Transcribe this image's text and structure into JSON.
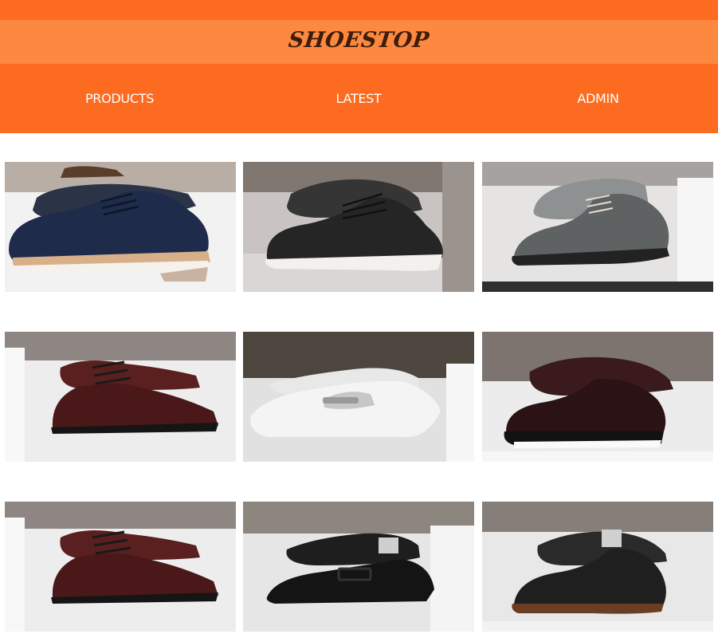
{
  "header": {
    "brand": "SHOESTOP"
  },
  "nav": {
    "items": [
      "PRODUCTS",
      "LATEST",
      "ADMIN"
    ]
  },
  "colors": {
    "accent": "#fc6b1f",
    "accent_light": "#fd8840",
    "brand_text": "#3e1d0b"
  },
  "products": [
    {
      "kind": "navy-perforated-derby"
    },
    {
      "kind": "black-perforated-derby"
    },
    {
      "kind": "grey-suede-chukka"
    },
    {
      "kind": "burgundy-leather-oxford"
    },
    {
      "kind": "white-driving-loafer"
    },
    {
      "kind": "burgundy-wingtip-sneaker"
    },
    {
      "kind": "burgundy-leather-oxford"
    },
    {
      "kind": "black-monk-strap"
    },
    {
      "kind": "black-wingtip-brogue"
    }
  ]
}
